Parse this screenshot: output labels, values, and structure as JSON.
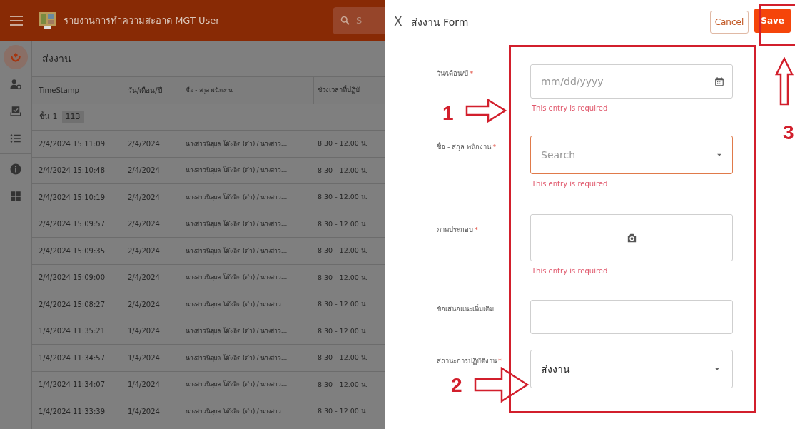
{
  "app": {
    "title": "รายงานการทำความสะอาด MGT User",
    "search_text": "S",
    "sidebar": [
      {
        "selected": true
      },
      {
        "selected": false
      },
      {
        "selected": false
      },
      {
        "selected": false
      },
      {
        "selected": false
      },
      {
        "selected": false
      }
    ],
    "page_title": "ส่งงาน",
    "table": {
      "columns": [
        "TimeStamp",
        "วัน/เดือน/ปี",
        "ชื่อ - สกุล พนักงาน",
        "ช่วงเวลาที่ปฏิบั"
      ],
      "group": {
        "label": "ชั้น 1",
        "count": "113"
      },
      "rows": [
        [
          "2/4/2024 15:11:09",
          "2/4/2024",
          "นางสาวนิลุบล โต๊ะอิด (ดำ) / นางสาว…",
          "8.30 - 12.00 น."
        ],
        [
          "2/4/2024 15:10:48",
          "2/4/2024",
          "นางสาวนิลุบล โต๊ะอิด (ดำ) / นางสาว…",
          "8.30 - 12.00 น."
        ],
        [
          "2/4/2024 15:10:19",
          "2/4/2024",
          "นางสาวนิลุบล โต๊ะอิด (ดำ) / นางสาว…",
          "8.30 - 12.00 น."
        ],
        [
          "2/4/2024 15:09:57",
          "2/4/2024",
          "นางสาวนิลุบล โต๊ะอิด (ดำ) / นางสาว…",
          "8.30 - 12.00 น."
        ],
        [
          "2/4/2024 15:09:35",
          "2/4/2024",
          "นางสาวนิลุบล โต๊ะอิด (ดำ) / นางสาว…",
          "8.30 - 12.00 น."
        ],
        [
          "2/4/2024 15:09:00",
          "2/4/2024",
          "นางสาวนิลุบล โต๊ะอิด (ดำ) / นางสาว…",
          "8.30 - 12.00 น."
        ],
        [
          "2/4/2024 15:08:27",
          "2/4/2024",
          "นางสาวนิลุบล โต๊ะอิด (ดำ) / นางสาว…",
          "8.30 - 12.00 น."
        ],
        [
          "1/4/2024 11:35:21",
          "1/4/2024",
          "นางสาวนิลุบล โต๊ะอิด (ดำ) / นางสาว…",
          "8.30 - 12.00 น."
        ],
        [
          "1/4/2024 11:34:57",
          "1/4/2024",
          "นางสาวนิลุบล โต๊ะอิด (ดำ) / นางสาว…",
          "8.30 - 12.00 น."
        ],
        [
          "1/4/2024 11:34:07",
          "1/4/2024",
          "นางสาวนิลุบล โต๊ะอิด (ดำ) / นางสาว…",
          "8.30 - 12.00 น."
        ],
        [
          "1/4/2024 11:33:39",
          "1/4/2024",
          "นางสาวนิลุบล โต๊ะอิด (ดำ) / นางสาว…",
          "8.30 - 12.00 น."
        ]
      ]
    }
  },
  "form": {
    "close": "X",
    "title": "ส่งงาน Form",
    "cancel": "Cancel",
    "save": "Save",
    "fields": [
      {
        "kind": "date",
        "label": "วัน/เดือน/ปี",
        "required_mark": "*",
        "placeholder": "mm/dd/yyyy",
        "error": "This entry is required"
      },
      {
        "kind": "select",
        "label": "ชื่อ - สกุล พนักงาน",
        "required_mark": "*",
        "placeholder": "Search",
        "focused": true,
        "error": "This entry is required"
      },
      {
        "kind": "photo",
        "label": "ภาพประกอบ",
        "required_mark": "*",
        "error": "This entry is required"
      },
      {
        "kind": "text",
        "label": "ข้อเสนอแนะเพิ่มเติม"
      },
      {
        "kind": "select",
        "label": "สถานะการปฏิบัติงาน",
        "required_mark": "*",
        "value": "ส่งงาน",
        "focused": false
      }
    ]
  },
  "annotations": [
    {
      "kind": "arrow-right",
      "label": "1"
    },
    {
      "kind": "arrow-right",
      "label": "2"
    },
    {
      "kind": "arrow-up",
      "label": "3"
    }
  ]
}
